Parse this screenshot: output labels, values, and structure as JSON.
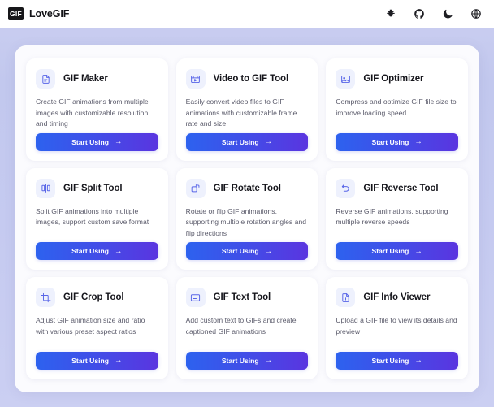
{
  "header": {
    "logo_text": "GIF",
    "brand_name": "LoveGIF",
    "actions": [
      {
        "name": "bug-icon",
        "label": "Bug"
      },
      {
        "name": "github-icon",
        "label": "GitHub"
      },
      {
        "name": "moon-icon",
        "label": "Dark mode"
      },
      {
        "name": "globe-icon",
        "label": "Language"
      }
    ]
  },
  "colors": {
    "brand_dark": "#17171a",
    "accent_blue": "#2d62ef",
    "accent_purple": "#5a35e0",
    "icon_tint": "#5865e8",
    "icon_bg": "#eef1fd",
    "page_bg": "#c5caf0",
    "panel_bg": "#fbfbfe"
  },
  "cards": [
    {
      "icon": "file-document-icon",
      "title": "GIF Maker",
      "description": "Create GIF animations from multiple images with customizable resolution and timing",
      "button_label": "Start Using",
      "button_arrow": "→"
    },
    {
      "icon": "video-icon",
      "title": "Video to GIF Tool",
      "description": "Easily convert video files to GIF animations with customizable frame rate and size",
      "button_label": "Start Using",
      "button_arrow": "→"
    },
    {
      "icon": "image-icon",
      "title": "GIF Optimizer",
      "description": "Compress and optimize GIF file size to improve loading speed",
      "button_label": "Start Using",
      "button_arrow": "→"
    },
    {
      "icon": "split-icon",
      "title": "GIF Split Tool",
      "description": "Split GIF animations into multiple images, support custom save format",
      "button_label": "Start Using",
      "button_arrow": "→"
    },
    {
      "icon": "rotate-icon",
      "title": "GIF Rotate Tool",
      "description": "Rotate or flip GIF animations, supporting multiple rotation angles and flip directions",
      "button_label": "Start Using",
      "button_arrow": "→"
    },
    {
      "icon": "reverse-arrow-icon",
      "title": "GIF Reverse Tool",
      "description": "Reverse GIF animations, supporting multiple reverse speeds",
      "button_label": "Start Using",
      "button_arrow": "→"
    },
    {
      "icon": "crop-icon",
      "title": "GIF Crop Tool",
      "description": "Adjust GIF animation size and ratio with various preset aspect ratios",
      "button_label": "Start Using",
      "button_arrow": "→"
    },
    {
      "icon": "text-caption-icon",
      "title": "GIF Text Tool",
      "description": "Add custom text to GIFs and create captioned GIF animations",
      "button_label": "Start Using",
      "button_arrow": "→"
    },
    {
      "icon": "file-info-icon",
      "title": "GIF Info Viewer",
      "description": "Upload a GIF file to view its details and preview",
      "button_label": "Start Using",
      "button_arrow": "→"
    }
  ]
}
